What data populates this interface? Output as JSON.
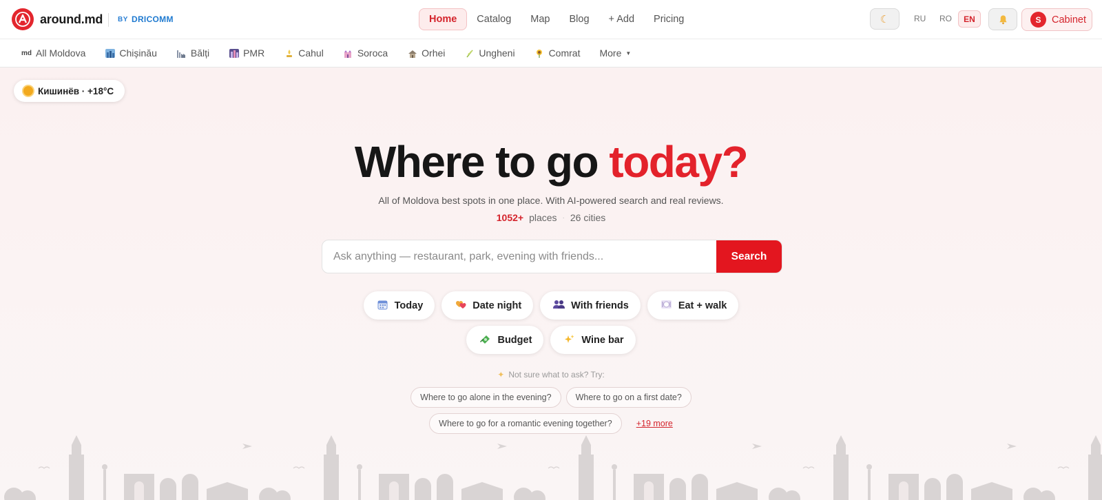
{
  "brand": {
    "name": "around.md",
    "by_label": "BY",
    "by_brand": "DRICOMM",
    "accent": "#e3222b"
  },
  "main_nav": {
    "items": [
      {
        "label": "Home",
        "active": true
      },
      {
        "label": "Catalog"
      },
      {
        "label": "Map"
      },
      {
        "label": "Blog"
      },
      {
        "label": "+ Add"
      },
      {
        "label": "Pricing"
      }
    ]
  },
  "header_right": {
    "theme_icon": "moon-icon",
    "languages": [
      "RU",
      "RO",
      "EN"
    ],
    "active_language": "EN",
    "notify_icon": "bell-icon",
    "avatar_letter": "S",
    "cabinet_label": "Cabinet"
  },
  "citybar": {
    "all_flag": "MD",
    "all_label": "All Moldova",
    "cities": [
      {
        "label": "Chișinău",
        "icon": "cityscape-icon"
      },
      {
        "label": "Bălți",
        "icon": "factory-icon"
      },
      {
        "label": "PMR",
        "icon": "city-lights-icon"
      },
      {
        "label": "Cahul",
        "icon": "fountain-icon"
      },
      {
        "label": "Soroca",
        "icon": "castle-icon"
      },
      {
        "label": "Orhei",
        "icon": "monastery-icon"
      },
      {
        "label": "Ungheni",
        "icon": "sprout-icon"
      },
      {
        "label": "Comrat",
        "icon": "sunflower-icon"
      }
    ],
    "more_label": "More"
  },
  "weather": {
    "label": "Кишинёв · +18°C",
    "icon": "sun-icon"
  },
  "hero": {
    "title_main": "Where to go ",
    "title_accent": "today?",
    "subtitle": "All of Moldova best spots in one place. With AI-powered search and real reviews.",
    "places_count": "1052+",
    "places_label": "places",
    "separator": "·",
    "cities_label": "26 cities"
  },
  "search": {
    "placeholder": "Ask anything — restaurant, park, evening with friends...",
    "value": "",
    "button_label": "Search"
  },
  "quick_chips": [
    {
      "label": "Today",
      "icon": "calendar-icon"
    },
    {
      "label": "Date night",
      "icon": "hearts-icon"
    },
    {
      "label": "With friends",
      "icon": "people-icon"
    },
    {
      "label": "Eat + walk",
      "icon": "plate-icon"
    },
    {
      "label": "Budget",
      "icon": "money-icon"
    },
    {
      "label": "Wine bar",
      "icon": "sparkles-icon"
    }
  ],
  "suggestions": {
    "label": "Not sure what to ask? Try:",
    "items": [
      "Where to go alone in the evening?",
      "Where to go on a first date?",
      "Where to go for a romantic evening together?"
    ],
    "more_label": "+19 more"
  }
}
